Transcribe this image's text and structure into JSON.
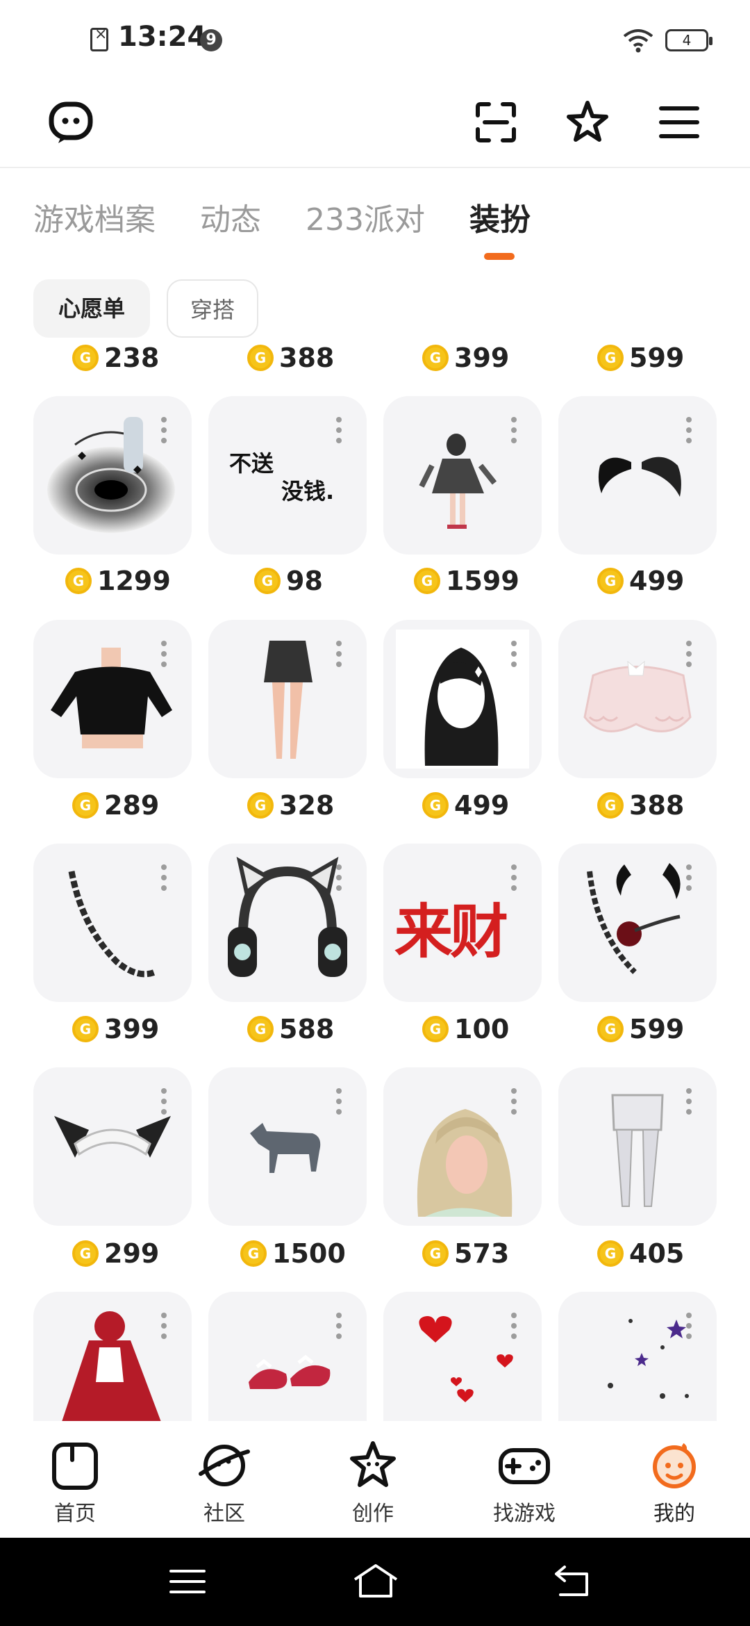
{
  "status_bar": {
    "time": "13:24",
    "notif_badge": "9",
    "battery": "4"
  },
  "tabs": [
    {
      "label": "游戏档案"
    },
    {
      "label": "动态"
    },
    {
      "label": "233派对"
    },
    {
      "label": "装扮",
      "active": true
    }
  ],
  "chips": {
    "wishlist": "心愿单",
    "outfit": "穿搭"
  },
  "grid": {
    "top_prices": [
      "238",
      "388",
      "399",
      "599"
    ],
    "rows": [
      {
        "items": [
          {
            "name": "black-vortex-effect",
            "price": "1299"
          },
          {
            "name": "text-sticker",
            "text1": "不送",
            "text2": "没钱.",
            "price": "98"
          },
          {
            "name": "gothic-dress-avatar",
            "price": "1599"
          },
          {
            "name": "black-wings",
            "price": "499"
          }
        ]
      },
      {
        "items": [
          {
            "name": "black-crop-top",
            "price": "289"
          },
          {
            "name": "black-mini-skirt",
            "price": "328"
          },
          {
            "name": "long-black-hair",
            "price": "499"
          },
          {
            "name": "pink-frilly-bloomers",
            "price": "388"
          }
        ]
      },
      {
        "items": [
          {
            "name": "black-braid",
            "price": "399"
          },
          {
            "name": "cat-ear-headphones",
            "price": "588"
          },
          {
            "name": "red-calligraphy-sticker",
            "text1": "来财",
            "price": "100"
          },
          {
            "name": "horns-and-braid",
            "price": "599"
          }
        ]
      },
      {
        "items": [
          {
            "name": "cat-ear-maid-headband",
            "price": "299"
          },
          {
            "name": "grey-wolf",
            "price": "1500"
          },
          {
            "name": "blonde-hair",
            "price": "573"
          },
          {
            "name": "white-stockings",
            "price": "405"
          }
        ]
      },
      {
        "items": [
          {
            "name": "red-riding-hood-cloak"
          },
          {
            "name": "red-lolita-shoes"
          },
          {
            "name": "red-hearts-effect"
          },
          {
            "name": "purple-stars-effect"
          }
        ]
      }
    ]
  },
  "bottom_nav": [
    {
      "label": "首页"
    },
    {
      "label": "社区"
    },
    {
      "label": "创作"
    },
    {
      "label": "找游戏"
    },
    {
      "label": "我的",
      "active": true
    }
  ],
  "colors": {
    "accent": "#f26b1d",
    "coin": "#f6c41a",
    "card_bg": "#f4f4f6"
  }
}
